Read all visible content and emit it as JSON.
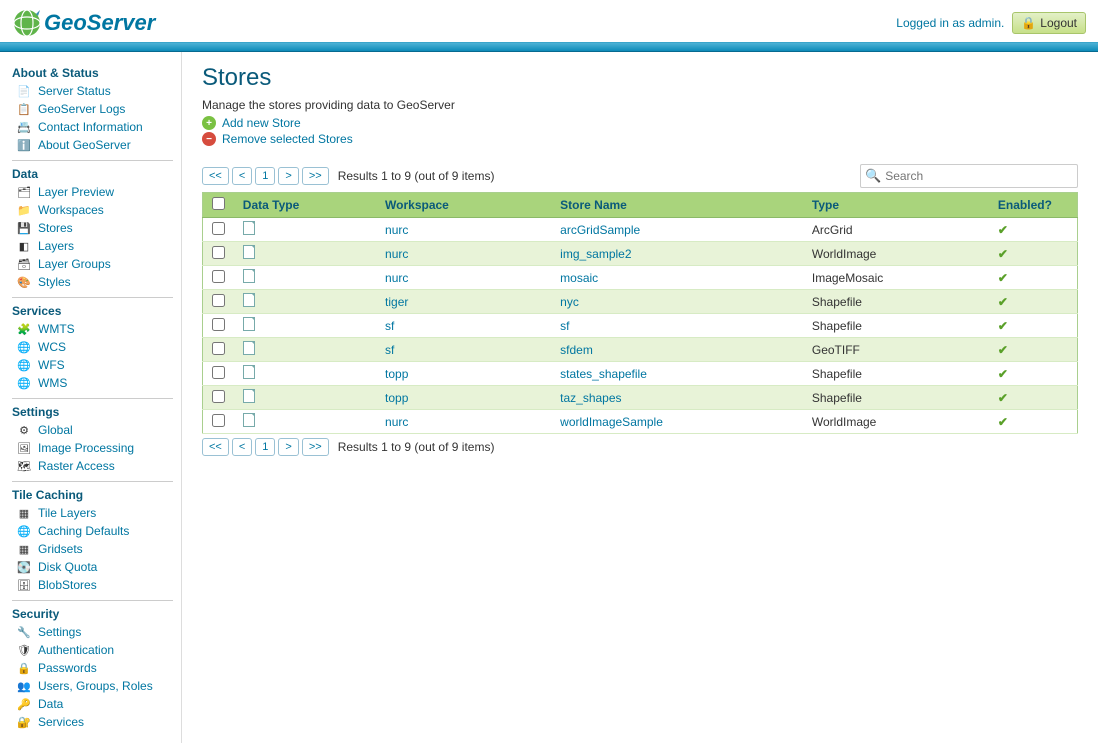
{
  "header": {
    "logo_text": "GeoServer",
    "logged_in": "Logged in as admin.",
    "logout": "Logout"
  },
  "sidebar": {
    "sections": [
      {
        "title": "About & Status",
        "items": [
          {
            "label": "Server Status",
            "icon": "📄"
          },
          {
            "label": "GeoServer Logs",
            "icon": "📋"
          },
          {
            "label": "Contact Information",
            "icon": "📇"
          },
          {
            "label": "About GeoServer",
            "icon": "ℹ️"
          }
        ]
      },
      {
        "title": "Data",
        "items": [
          {
            "label": "Layer Preview",
            "icon": "🗂"
          },
          {
            "label": "Workspaces",
            "icon": "📁"
          },
          {
            "label": "Stores",
            "icon": "💾"
          },
          {
            "label": "Layers",
            "icon": "◧"
          },
          {
            "label": "Layer Groups",
            "icon": "🗃"
          },
          {
            "label": "Styles",
            "icon": "🎨"
          }
        ]
      },
      {
        "title": "Services",
        "items": [
          {
            "label": "WMTS",
            "icon": "🧩"
          },
          {
            "label": "WCS",
            "icon": "🌐"
          },
          {
            "label": "WFS",
            "icon": "🌐"
          },
          {
            "label": "WMS",
            "icon": "🌐"
          }
        ]
      },
      {
        "title": "Settings",
        "items": [
          {
            "label": "Global",
            "icon": "⚙"
          },
          {
            "label": "Image Processing",
            "icon": "🖼"
          },
          {
            "label": "Raster Access",
            "icon": "🗺"
          }
        ]
      },
      {
        "title": "Tile Caching",
        "items": [
          {
            "label": "Tile Layers",
            "icon": "▦"
          },
          {
            "label": "Caching Defaults",
            "icon": "🌐"
          },
          {
            "label": "Gridsets",
            "icon": "▦"
          },
          {
            "label": "Disk Quota",
            "icon": "💽"
          },
          {
            "label": "BlobStores",
            "icon": "🗄"
          }
        ]
      },
      {
        "title": "Security",
        "items": [
          {
            "label": "Settings",
            "icon": "🔧"
          },
          {
            "label": "Authentication",
            "icon": "🛡"
          },
          {
            "label": "Passwords",
            "icon": "🔒"
          },
          {
            "label": "Users, Groups, Roles",
            "icon": "👥"
          },
          {
            "label": "Data",
            "icon": "🔑"
          },
          {
            "label": "Services",
            "icon": "🔐"
          }
        ]
      }
    ]
  },
  "page": {
    "title": "Stores",
    "description": "Manage the stores providing data to GeoServer",
    "add_label": "Add new Store",
    "remove_label": "Remove selected Stores"
  },
  "pager": {
    "first": "<<",
    "prev": "<",
    "page": "1",
    "next": ">",
    "last": ">>",
    "summary": "Results 1 to 9 (out of 9 items)"
  },
  "search": {
    "placeholder": "Search"
  },
  "table": {
    "headers": {
      "data_type": "Data Type",
      "workspace": "Workspace",
      "store_name": "Store Name",
      "type": "Type",
      "enabled": "Enabled?"
    },
    "rows": [
      {
        "workspace": "nurc",
        "store_name": "arcGridSample",
        "type": "ArcGrid",
        "enabled": true
      },
      {
        "workspace": "nurc",
        "store_name": "img_sample2",
        "type": "WorldImage",
        "enabled": true
      },
      {
        "workspace": "nurc",
        "store_name": "mosaic",
        "type": "ImageMosaic",
        "enabled": true
      },
      {
        "workspace": "tiger",
        "store_name": "nyc",
        "type": "Shapefile",
        "enabled": true
      },
      {
        "workspace": "sf",
        "store_name": "sf",
        "type": "Shapefile",
        "enabled": true
      },
      {
        "workspace": "sf",
        "store_name": "sfdem",
        "type": "GeoTIFF",
        "enabled": true
      },
      {
        "workspace": "topp",
        "store_name": "states_shapefile",
        "type": "Shapefile",
        "enabled": true
      },
      {
        "workspace": "topp",
        "store_name": "taz_shapes",
        "type": "Shapefile",
        "enabled": true
      },
      {
        "workspace": "nurc",
        "store_name": "worldImageSample",
        "type": "WorldImage",
        "enabled": true
      }
    ]
  }
}
